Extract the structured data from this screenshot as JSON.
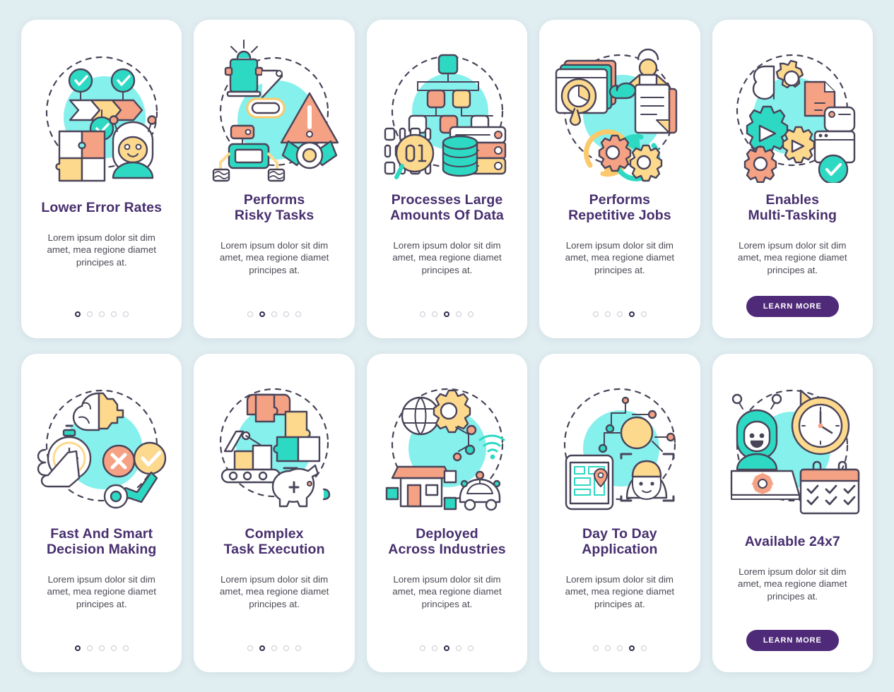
{
  "theme": {
    "background": "#e0edf1",
    "card_background": "#ffffff",
    "title_color": "#472f6e",
    "body_color": "#4a4a55",
    "button_color": "#4e2a78",
    "button_text_color": "#ffffff",
    "dot_active_color": "#332a4e",
    "dot_inactive_color": "#c9c9d4",
    "illustration_palette": {
      "teal": "#2ED9C3",
      "cyan_fill": "#86F0EC",
      "salmon": "#F5A183",
      "gold": "#FBC96B",
      "gold_light": "#FDD98E",
      "outline": "#4A4459",
      "white": "#FFFFFF"
    }
  },
  "common": {
    "body_text": "Lorem ipsum dolor sit dim\namet, mea regione diamet\nprincipes at.",
    "learn_more_label": "LEARN MORE",
    "dots_total": 5
  },
  "cards": [
    {
      "title": "Lower Error Rates",
      "title_lines": 1,
      "body": "Lorem ipsum dolor sit dim\namet, mea regione diamet\nprincipes at.",
      "footer_type": "dots",
      "active_dot": 1,
      "illustration": "checkmarks-arrows-puzzle-robot-icon"
    },
    {
      "title": "Performs\nRisky Tasks",
      "title_lines": 2,
      "body": "Lorem ipsum dolor sit dim\namet, mea regione diamet\nprincipes at.",
      "footer_type": "dots",
      "active_dot": 2,
      "illustration": "alarm-robot-warning-icon"
    },
    {
      "title": "Processes Large\nAmounts Of Data",
      "title_lines": 2,
      "body": "Lorem ipsum dolor sit dim\namet, mea regione diamet\nprincipes at.",
      "footer_type": "dots",
      "active_dot": 3,
      "illustration": "binary-database-network-icon"
    },
    {
      "title": "Performs\nRepetitive Jobs",
      "title_lines": 2,
      "body": "Lorem ipsum dolor sit dim\namet, mea regione diamet\nprincipes at.",
      "footer_type": "dots",
      "active_dot": 4,
      "illustration": "documents-gears-recycle-icon"
    },
    {
      "title": "Enables\nMulti-Tasking",
      "title_lines": 2,
      "body": "Lorem ipsum dolor sit dim\namet, mea regione diamet\nprincipes at.",
      "footer_type": "button",
      "button_label": "LEARN MORE",
      "illustration": "brain-gears-multitask-icon"
    },
    {
      "title": "Fast And Smart\nDecision Making",
      "title_lines": 2,
      "body": "Lorem ipsum dolor sit dim\namet, mea regione diamet\nprincipes at.",
      "footer_type": "dots",
      "active_dot": 1,
      "illustration": "brain-stopwatch-choice-icon"
    },
    {
      "title": "Complex\nTask Execution",
      "title_lines": 2,
      "body": "Lorem ipsum dolor sit dim\namet, mea regione diamet\nprincipes at.",
      "footer_type": "dots",
      "active_dot": 2,
      "illustration": "conveyor-puzzle-piggybank-icon"
    },
    {
      "title": "Deployed\nAcross Industries",
      "title_lines": 2,
      "body": "Lorem ipsum dolor sit dim\namet, mea regione diamet\nprincipes at.",
      "footer_type": "dots",
      "active_dot": 3,
      "illustration": "globe-shop-car-network-icon"
    },
    {
      "title": "Day To Day\nApplication",
      "title_lines": 2,
      "body": "Lorem ipsum dolor sit dim\namet, mea regione diamet\nprincipes at.",
      "footer_type": "dots",
      "active_dot": 4,
      "illustration": "map-phone-faceid-icon"
    },
    {
      "title": "Available 24x7",
      "title_lines": 1,
      "body": "Lorem ipsum dolor sit dim\namet, mea regione diamet\nprincipes at.",
      "footer_type": "button",
      "button_label": "LEARN MORE",
      "illustration": "robot-clock-calendar-icon"
    }
  ]
}
